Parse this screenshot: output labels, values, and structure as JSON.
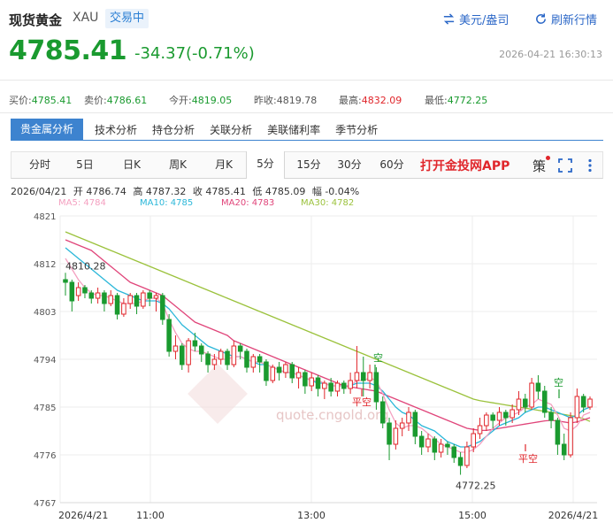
{
  "header": {
    "title": "现货黄金",
    "symbol": "XAU",
    "status_badge": "交易中",
    "currency_toggle_label": "美元/盎司",
    "refresh_label": "刷新行情",
    "accent_color": "#2b67c7"
  },
  "quote": {
    "price": "4785.41",
    "change": "-34.37(-0.71%)",
    "timestamp": "2026-04-21 16:30:13",
    "down_color": "#1a9a2f",
    "up_color": "#e0262b"
  },
  "stats": [
    {
      "label": "买价:",
      "value": "4785.41",
      "tone": "green"
    },
    {
      "label": "卖价:",
      "value": "4786.61",
      "tone": "green"
    },
    {
      "label": "今开:",
      "value": "4819.05",
      "tone": "green"
    },
    {
      "label": "昨收:",
      "value": "4819.78",
      "tone": "plain"
    },
    {
      "label": "最高:",
      "value": "4832.09",
      "tone": "red"
    },
    {
      "label": "最低:",
      "value": "4772.25",
      "tone": "green"
    }
  ],
  "analysis_tabs": [
    "贵金属分析",
    "技术分析",
    "持仓分析",
    "关联分析",
    "美联储利率",
    "季节分析"
  ],
  "period_tabs": [
    "分时",
    "5日",
    "日K",
    "周K",
    "月K",
    "5分",
    "15分",
    "30分",
    "60分"
  ],
  "active_period": "5分",
  "app_link": "打开金投网APP",
  "strategy_label": "策",
  "tool_icons": [
    "fullscreen-icon",
    "more-icon"
  ],
  "candle_info": {
    "date": "2026/04/21",
    "open": "开 4786.74",
    "high": "高 4787.32",
    "close": "收 4785.41",
    "low": "低 4785.09",
    "amplitude": "幅 -0.04%"
  },
  "ma_legend": [
    {
      "label": "MA5: 4784",
      "color": "#f4a0c0"
    },
    {
      "label": "MA10: 4785",
      "color": "#2bb7d9"
    },
    {
      "label": "MA20: 4783",
      "color": "#e0457a"
    },
    {
      "label": "MA30: 4782",
      "color": "#9bc23c"
    }
  ],
  "watermark": {
    "url": "quote.cngold.org"
  },
  "chart_data": {
    "type": "candlestick",
    "y_ticks": [
      4821,
      4812,
      4803,
      4794,
      4785,
      4776,
      4767
    ],
    "ylim": [
      4767,
      4821
    ],
    "x_ticks": [
      "2026/4/21",
      "11:00",
      "13:00",
      "15:00",
      "2026/4/21"
    ],
    "annotations": {
      "high_label": "4810.28",
      "low_label": "4772.25",
      "signals": [
        {
          "text": "空",
          "kind": "short"
        },
        {
          "text": "平空",
          "kind": "cover"
        },
        {
          "text": "平空",
          "kind": "cover"
        },
        {
          "text": "空",
          "kind": "short"
        }
      ]
    },
    "candles": [
      [
        4809.0,
        4808.5,
        4810.3,
        4806.0
      ],
      [
        4808.5,
        4805.0,
        4809.0,
        4803.0
      ],
      [
        4806.0,
        4807.5,
        4808.5,
        4805.0
      ],
      [
        4807.5,
        4806.5,
        4808.0,
        4805.5
      ],
      [
        4806.5,
        4805.5,
        4807.0,
        4804.5
      ],
      [
        4805.5,
        4806.5,
        4807.5,
        4804.5
      ],
      [
        4806.5,
        4804.5,
        4807.0,
        4803.0
      ],
      [
        4804.5,
        4806.0,
        4807.0,
        4804.0
      ],
      [
        4806.0,
        4802.5,
        4806.5,
        4801.5
      ],
      [
        4802.5,
        4804.5,
        4805.5,
        4802.0
      ],
      [
        4804.5,
        4806.0,
        4806.5,
        4803.5
      ],
      [
        4806.0,
        4804.0,
        4806.5,
        4802.5
      ],
      [
        4804.0,
        4806.5,
        4807.0,
        4803.5
      ],
      [
        4806.5,
        4805.5,
        4807.0,
        4804.0
      ],
      [
        4805.5,
        4806.0,
        4806.5,
        4803.0
      ],
      [
        4806.0,
        4801.5,
        4806.5,
        4800.5
      ],
      [
        4801.5,
        4795.5,
        4802.5,
        4794.5
      ],
      [
        4795.5,
        4796.5,
        4798.5,
        4794.0
      ],
      [
        4796.5,
        4793.0,
        4797.0,
        4792.0
      ],
      [
        4793.0,
        4797.5,
        4798.0,
        4791.5
      ],
      [
        4797.5,
        4796.5,
        4799.0,
        4795.5
      ],
      [
        4796.5,
        4795.0,
        4797.0,
        4793.5
      ],
      [
        4795.0,
        4793.0,
        4795.5,
        4791.5
      ],
      [
        4793.0,
        4794.0,
        4795.0,
        4792.0
      ],
      [
        4794.0,
        4795.5,
        4796.0,
        4793.0
      ],
      [
        4795.5,
        4793.0,
        4796.0,
        4792.0
      ],
      [
        4793.0,
        4796.5,
        4797.5,
        4792.5
      ],
      [
        4796.5,
        4795.5,
        4797.0,
        4794.0
      ],
      [
        4795.5,
        4792.5,
        4796.0,
        4791.5
      ],
      [
        4792.5,
        4794.5,
        4795.0,
        4791.5
      ],
      [
        4794.5,
        4793.5,
        4795.0,
        4791.5
      ],
      [
        4793.5,
        4790.0,
        4794.0,
        4789.0
      ],
      [
        4790.0,
        4792.5,
        4793.0,
        4789.5
      ],
      [
        4792.5,
        4791.5,
        4793.5,
        4790.0
      ],
      [
        4791.5,
        4793.0,
        4793.5,
        4790.5
      ],
      [
        4793.0,
        4790.5,
        4793.5,
        4789.5
      ],
      [
        4790.5,
        4791.5,
        4792.5,
        4788.5
      ],
      [
        4791.5,
        4789.0,
        4792.0,
        4787.5
      ],
      [
        4789.0,
        4790.5,
        4791.5,
        4788.0
      ],
      [
        4790.5,
        4788.5,
        4791.0,
        4787.0
      ],
      [
        4788.5,
        4789.5,
        4790.0,
        4786.5
      ],
      [
        4789.5,
        4788.0,
        4790.5,
        4787.0
      ],
      [
        4788.0,
        4789.5,
        4790.0,
        4787.0
      ],
      [
        4789.5,
        4788.5,
        4790.0,
        4787.5
      ],
      [
        4788.5,
        4790.0,
        4791.5,
        4787.5
      ],
      [
        4790.0,
        4791.5,
        4796.5,
        4788.5
      ],
      [
        4791.5,
        4790.0,
        4794.5,
        4787.0
      ],
      [
        4790.0,
        4791.5,
        4793.0,
        4788.5
      ],
      [
        4791.5,
        4786.0,
        4792.5,
        4784.5
      ],
      [
        4786.0,
        4782.0,
        4787.0,
        4781.0
      ],
      [
        4782.0,
        4778.0,
        4783.0,
        4775.0
      ],
      [
        4778.0,
        4781.0,
        4782.5,
        4777.0
      ],
      [
        4781.0,
        4782.0,
        4783.0,
        4779.5
      ],
      [
        4782.0,
        4784.0,
        4785.0,
        4780.5
      ],
      [
        4784.0,
        4779.5,
        4784.5,
        4778.0
      ],
      [
        4779.5,
        4777.5,
        4780.5,
        4776.0
      ],
      [
        4777.5,
        4779.0,
        4780.0,
        4776.5
      ],
      [
        4779.0,
        4776.5,
        4779.5,
        4775.0
      ],
      [
        4776.5,
        4778.0,
        4779.0,
        4775.5
      ],
      [
        4778.0,
        4777.5,
        4778.5,
        4776.0
      ],
      [
        4777.5,
        4775.5,
        4778.0,
        4774.5
      ],
      [
        4775.5,
        4774.0,
        4776.5,
        4772.25
      ],
      [
        4774.0,
        4777.5,
        4778.5,
        4773.5
      ],
      [
        4777.5,
        4780.0,
        4781.0,
        4776.5
      ],
      [
        4780.0,
        4781.5,
        4783.0,
        4779.0
      ],
      [
        4781.5,
        4783.5,
        4784.0,
        4780.5
      ],
      [
        4783.5,
        4782.5,
        4784.0,
        4781.0
      ],
      [
        4782.5,
        4784.0,
        4785.0,
        4781.5
      ],
      [
        4784.0,
        4783.0,
        4784.5,
        4781.5
      ],
      [
        4783.0,
        4784.5,
        4785.5,
        4782.0
      ],
      [
        4784.5,
        4786.5,
        4788.0,
        4783.5
      ],
      [
        4786.5,
        4785.0,
        4787.5,
        4784.0
      ],
      [
        4785.0,
        4789.5,
        4790.5,
        4784.5
      ],
      [
        4789.5,
        4788.0,
        4791.0,
        4786.5
      ],
      [
        4788.0,
        4784.0,
        4789.0,
        4783.0
      ],
      [
        4784.0,
        4782.5,
        4785.0,
        4781.0
      ],
      [
        4782.5,
        4778.0,
        4783.0,
        4776.0
      ],
      [
        4778.0,
        4776.0,
        4780.0,
        4775.0
      ],
      [
        4776.0,
        4783.0,
        4784.0,
        4775.5
      ],
      [
        4783.0,
        4787.0,
        4788.5,
        4782.0
      ],
      [
        4787.0,
        4785.0,
        4787.5,
        4784.0
      ],
      [
        4785.0,
        4786.5,
        4787.0,
        4784.5
      ]
    ],
    "ma_lines": {
      "MA30": [
        4818,
        4817.5,
        4817,
        4816.5,
        4816,
        4815.5,
        4815,
        4814.5,
        4814,
        4813.5,
        4813,
        4812.5,
        4812,
        4811.5,
        4811,
        4810.5,
        4810,
        4809.5,
        4809,
        4808.5,
        4808,
        4807.5,
        4807,
        4806.5,
        4806,
        4805.5,
        4805,
        4804.5,
        4804,
        4803.5,
        4803,
        4802.5,
        4802,
        4801.5,
        4801,
        4800.5,
        4800,
        4799.5,
        4799,
        4798.5,
        4798,
        4797.5,
        4797,
        4796.5,
        4796,
        4795.5,
        4795,
        4794.5,
        4794,
        4793.5,
        4793,
        4792.5,
        4792,
        4791.5,
        4791,
        4790.5,
        4790,
        4789.5,
        4789,
        4788.5,
        4788,
        4787.5,
        4787,
        4786.5,
        4786.2,
        4786,
        4785.8,
        4785.6,
        4785.4,
        4785.2,
        4785,
        4784.8,
        4784.6,
        4784.4,
        4784.2,
        4784,
        4783.8,
        4783.6,
        4783.4,
        4783.2,
        4782.8,
        4782.3
      ],
      "MA20": [
        4816.5,
        4816,
        4815.5,
        4815,
        4814.5,
        4813.5,
        4812.5,
        4811.5,
        4810.5,
        4809.5,
        4808.5,
        4808,
        4807.5,
        4807,
        4806.5,
        4806,
        4805,
        4804,
        4803,
        4802,
        4801,
        4800.5,
        4800,
        4799.5,
        4799,
        4798.5,
        4797.5,
        4797,
        4796.5,
        4796,
        4795.5,
        4795,
        4794.5,
        4794,
        4793.5,
        4793,
        4792.5,
        4792,
        4791.5,
        4791,
        4790.5,
        4790,
        4789.5,
        4789,
        4788.8,
        4788.6,
        4788.4,
        4788.2,
        4788,
        4787.5,
        4787,
        4786.5,
        4786,
        4785.5,
        4785,
        4784.5,
        4784,
        4783.5,
        4783,
        4782.5,
        4782,
        4781.5,
        4781,
        4780.8,
        4780.6,
        4780.6,
        4780.8,
        4781,
        4781.2,
        4781.4,
        4781.6,
        4781.8,
        4782,
        4782.2,
        4782.4,
        4782.5,
        4782.4,
        4782.2,
        4782,
        4782.2,
        4782.6,
        4783
      ],
      "MA10": [
        4815,
        4814,
        4813,
        4812,
        4811,
        4810,
        4809,
        4808,
        4807,
        4806.5,
        4806,
        4805.5,
        4805,
        4805,
        4805,
        4804.5,
        4803.5,
        4802,
        4800.5,
        4799.5,
        4798.5,
        4797.5,
        4796.5,
        4796,
        4795.5,
        4795,
        4794.5,
        4794.5,
        4794,
        4793.5,
        4793,
        4793,
        4792.5,
        4792,
        4791.5,
        4791.5,
        4791,
        4790.5,
        4790,
        4789.5,
        4789.5,
        4789,
        4789,
        4789,
        4789,
        4789.5,
        4789.5,
        4789.5,
        4789,
        4788,
        4786.5,
        4785,
        4784,
        4783.5,
        4782.5,
        4781.5,
        4781,
        4780.5,
        4779.5,
        4778.5,
        4778,
        4777.5,
        4777.5,
        4778,
        4778.5,
        4779.5,
        4780.5,
        4781.5,
        4782,
        4782.5,
        4783,
        4784,
        4784.5,
        4785,
        4785,
        4784.5,
        4784,
        4783.5,
        4783,
        4783.5,
        4784.5,
        4785
      ],
      "MA5": [
        4813,
        4811,
        4809,
        4807.5,
        4806.5,
        4806,
        4806,
        4805.5,
        4805,
        4804.5,
        4804.5,
        4804.5,
        4805,
        4805.5,
        4805.5,
        4804.5,
        4801.5,
        4799,
        4797,
        4796,
        4795.5,
        4795.5,
        4795,
        4794.5,
        4794,
        4794,
        4794.5,
        4794.5,
        4794,
        4793.5,
        4793.5,
        4793,
        4792.5,
        4792,
        4791.5,
        4791.5,
        4791,
        4790.5,
        4790,
        4790,
        4789.5,
        4789,
        4789,
        4789,
        4789,
        4790,
        4790,
        4790.5,
        4790,
        4787.5,
        4784.5,
        4782,
        4781,
        4781.5,
        4781.5,
        4781,
        4780,
        4779,
        4778,
        4777.5,
        4777,
        4776.5,
        4776.5,
        4777,
        4778,
        4779.5,
        4781,
        4782,
        4783,
        4783.5,
        4784,
        4785,
        4785.5,
        4786.5,
        4786,
        4785.5,
        4783.5,
        4781,
        4780.5,
        4781.5,
        4783.5,
        4784
      ]
    }
  }
}
